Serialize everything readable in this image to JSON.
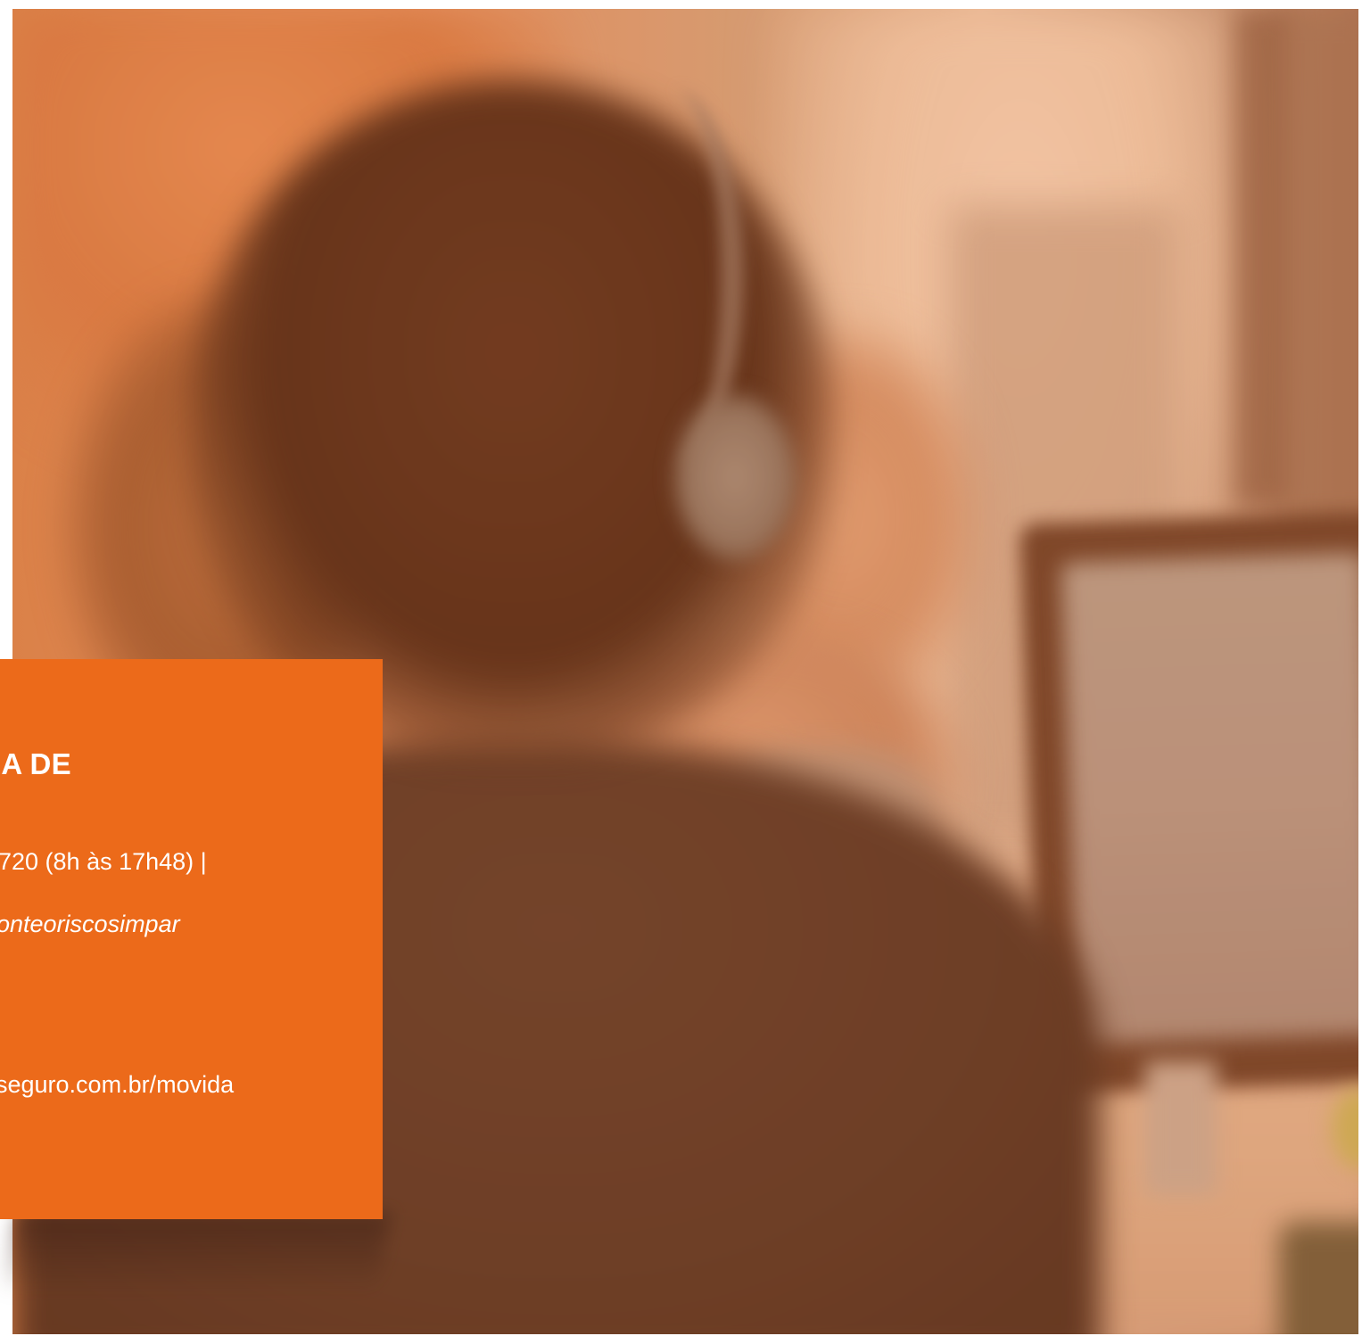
{
  "photo": {
    "description_icon": "person-with-headset-photo",
    "tint_color": "#e1783a"
  },
  "card": {
    "background_color": "#ec6a1a",
    "title": "IA DE",
    "phone_line": "720 (8h às 17h48) |",
    "social_line": "onteoriscosimpar",
    "site_line": "seguro.com.br/movida"
  }
}
